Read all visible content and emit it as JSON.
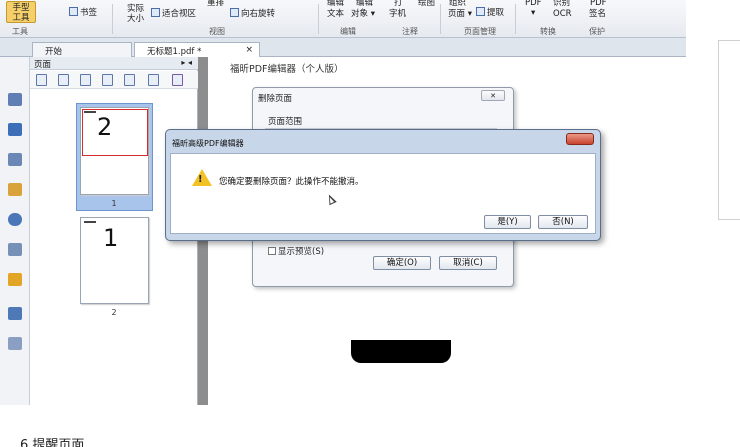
{
  "ribbon": {
    "hand_tool": "手型\n工具",
    "tool_group": "工具",
    "bookmark": "书签",
    "actual_size": "实际\n大小",
    "fit_view": "适合视区",
    "rotate_top": "重排",
    "rotate_right": "向右旋转",
    "view_group": "视图",
    "edit_text": "文本",
    "edit_object": "对象",
    "edit_top_1": "编辑",
    "edit_top_2": "编辑",
    "edit_group": "编辑",
    "typewriter_top": "打",
    "typewriter": "字机",
    "note_top": "绘图",
    "annotate_group": "注释",
    "page_top": "组织",
    "page": "页面",
    "extract": "提取",
    "page_manage_group": "页面管理",
    "ocr_top_1": "PDF",
    "ocr_top_2": "识别",
    "ocr": "OCR",
    "convert_group": "转换",
    "sign_top": "PDF",
    "sign": "签名",
    "protect_group": "保护"
  },
  "tabs": [
    {
      "label": "开始"
    },
    {
      "label": "无标题1.pdf *",
      "close": "×"
    }
  ],
  "panel": {
    "title": "页面",
    "pin": "▸ ◂",
    "thumbs": [
      {
        "number": "2",
        "label": "1"
      },
      {
        "number": "1",
        "label": "2"
      }
    ]
  },
  "doc": {
    "title": "福昕PDF编辑器（个人版）"
  },
  "delete_dialog": {
    "title": "删除页面",
    "close": "✕",
    "range_label": "页面范围",
    "preview_label": "显示预览(S)",
    "ok_label": "确定(O)",
    "cancel_label": "取消(C)"
  },
  "confirm_dialog": {
    "title": "福昕高级PDF编辑器",
    "message": "您确定要删除页面？此操作不能撤消。",
    "yes_label": "是(Y)",
    "no_label": "否(N)"
  },
  "footer": {
    "caption": "6.提醒页面"
  },
  "colors": {
    "selection": "#a9c4ea",
    "warning": "#f2c224",
    "close_button": "#c9442f"
  }
}
